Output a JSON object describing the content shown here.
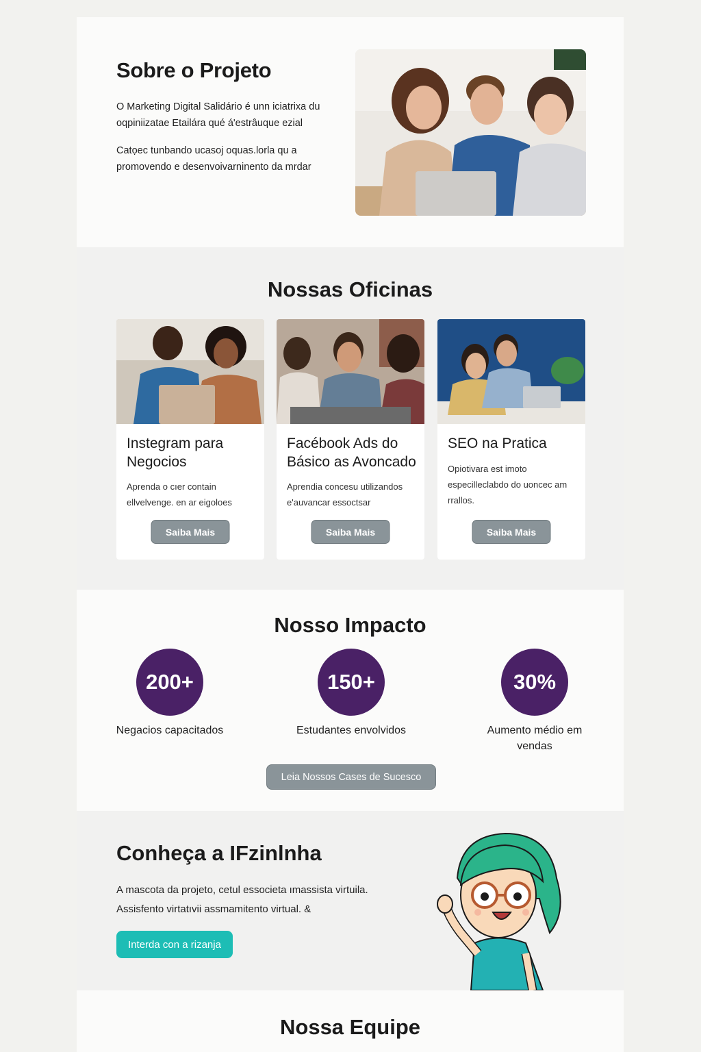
{
  "about": {
    "title": "Sobre o Projeto",
    "paragraph1": "O Marketing Digital Salidário é unn iciatrixa du oqpiniizatae Etailára qué á'estrâuque ezial",
    "paragraph2": "Catọec tunbando ucasoj oquas.lorla qu a promovendo e desenvoivarninento da mrdar",
    "image_icon": "team-photo"
  },
  "workshops": {
    "title": "Nossas Oficinas",
    "cards": [
      {
        "title": "Instegram para Negocios",
        "description": "Aprenda o cıer contain ellvelvenge. en ar eigoloes",
        "button": "Saiba Mais"
      },
      {
        "title": "Facébook Ads do Básico as Avoncado",
        "description": "Aprendia concesu utilizandos e'auvancar essoctsar",
        "button": "Saiba Mais"
      },
      {
        "title": "SEO na Pratica",
        "description": "Opiotivara est imoto especilleclabdo do uoncec am rrallos.",
        "button": "Saiba Mais"
      }
    ]
  },
  "impact": {
    "title": "Nosso Impacto",
    "stats": [
      {
        "value": "200+",
        "label": "Negacios capacitados"
      },
      {
        "value": "150+",
        "label": "Estudantes envolvidos"
      },
      {
        "value": "30%",
        "label": "Aumento médio em vendas"
      }
    ],
    "button": "Leia Nossos Cases de Sucesco",
    "circle_color": "#4a2166"
  },
  "mascot": {
    "title": "Conheça a IFzinlnha",
    "paragraph1": "A mascota da projeto, cetul essocieta ımassista virtuila.",
    "paragraph2": "Assisfento virtatıvii assmamitento virtual. &",
    "button": "Interda con a rizanja",
    "button_color": "#1dbdb5"
  },
  "team": {
    "title": "Nossa Equipe"
  }
}
